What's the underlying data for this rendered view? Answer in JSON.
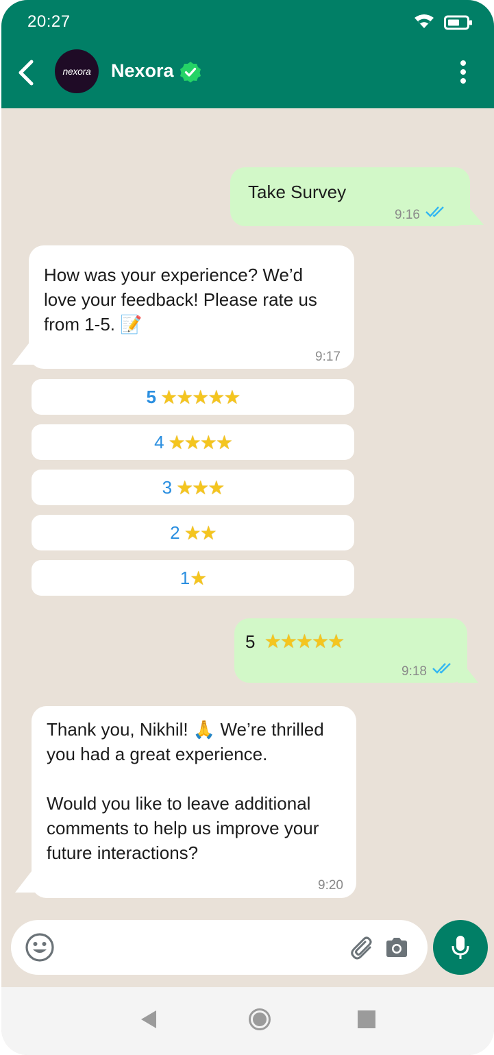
{
  "status": {
    "time": "20:27"
  },
  "header": {
    "name": "Nexora",
    "avatar_text": "nexora",
    "verified": true
  },
  "messages": [
    {
      "dir": "out",
      "text": "Take Survey",
      "time": "9:16",
      "read": true
    },
    {
      "dir": "in",
      "lines": [
        "How was your experience? We’d",
        "love your feedback! Please rate us",
        "from 1-5. 📝"
      ],
      "time": "9:17"
    },
    {
      "dir": "out",
      "text": "5 ⭐⭐⭐⭐⭐",
      "time": "9:18",
      "read": true
    },
    {
      "dir": "in",
      "lines": [
        "Thank you, Nikhil! 🙏 We’re thrilled",
        "you had a great experience.",
        "",
        "Would you like to leave additional",
        "comments to help us improve your",
        "future interactions?"
      ],
      "time": "9:20"
    }
  ],
  "rating_options": [
    {
      "label": "5",
      "stars": 5
    },
    {
      "label": "4",
      "stars": 4
    },
    {
      "label": "3",
      "stars": 3
    },
    {
      "label": "2",
      "stars": 2
    },
    {
      "label": "1",
      "stars": 1
    }
  ],
  "reply_5": {
    "num": "5",
    "stars": "★★★★★"
  },
  "opt_stars": {
    "s5": "★★★★★",
    "s4": "★★★★",
    "s3": "★★★",
    "s2": "★★",
    "s1": "★"
  },
  "colors": {
    "header": "#017f66",
    "outgoing": "#d2f8c8",
    "incoming": "#ffffff",
    "link": "#2b8fe0",
    "tick": "#34b7f1"
  },
  "icons": [
    "back-arrow-icon",
    "verified-icon",
    "more-vert-icon",
    "emoji-icon",
    "attach-icon",
    "camera-icon",
    "mic-icon"
  ]
}
